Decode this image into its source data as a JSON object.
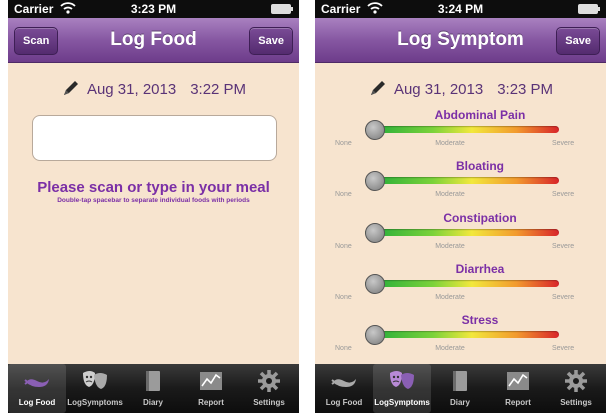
{
  "screens": [
    {
      "status": {
        "carrier": "Carrier",
        "time": "3:23 PM"
      },
      "nav": {
        "title": "Log Food",
        "left_button": "Scan",
        "right_button": "Save"
      },
      "date": "Aug 31, 2013",
      "time": "3:22 PM",
      "prompt": "Please scan or type in your meal",
      "hint": "Double-tap spacebar to separate individual foods with periods",
      "tabs": [
        "Log Food",
        "LogSymptoms",
        "Diary",
        "Report",
        "Settings"
      ],
      "selected_tab": 0
    },
    {
      "status": {
        "carrier": "Carrier",
        "time": "3:24 PM"
      },
      "nav": {
        "title": "Log Symptom",
        "right_button": "Save"
      },
      "date": "Aug 31, 2013",
      "time": "3:23 PM",
      "scale": {
        "none": "None",
        "moderate": "Moderate",
        "severe": "Severe"
      },
      "symptoms": [
        {
          "name": "Abdominal Pain",
          "level": 0
        },
        {
          "name": "Bloating",
          "level": 0
        },
        {
          "name": "Constipation",
          "level": 0
        },
        {
          "name": "Diarrhea",
          "level": 0
        },
        {
          "name": "Stress",
          "level": 0
        }
      ],
      "tabs": [
        "Log Food",
        "LogSymptoms",
        "Diary",
        "Report",
        "Settings"
      ],
      "selected_tab": 1
    }
  ],
  "icons": {
    "tabs": [
      "log-food-icon",
      "masks-icon",
      "diary-book-icon",
      "report-chart-icon",
      "gear-icon"
    ],
    "status": [
      "wifi-icon",
      "battery-icon"
    ],
    "edit": "pencil-icon"
  },
  "colors": {
    "nav_purple": "#8657a2",
    "accent_purple": "#7b2fa6",
    "background": "#f7e4cf"
  }
}
